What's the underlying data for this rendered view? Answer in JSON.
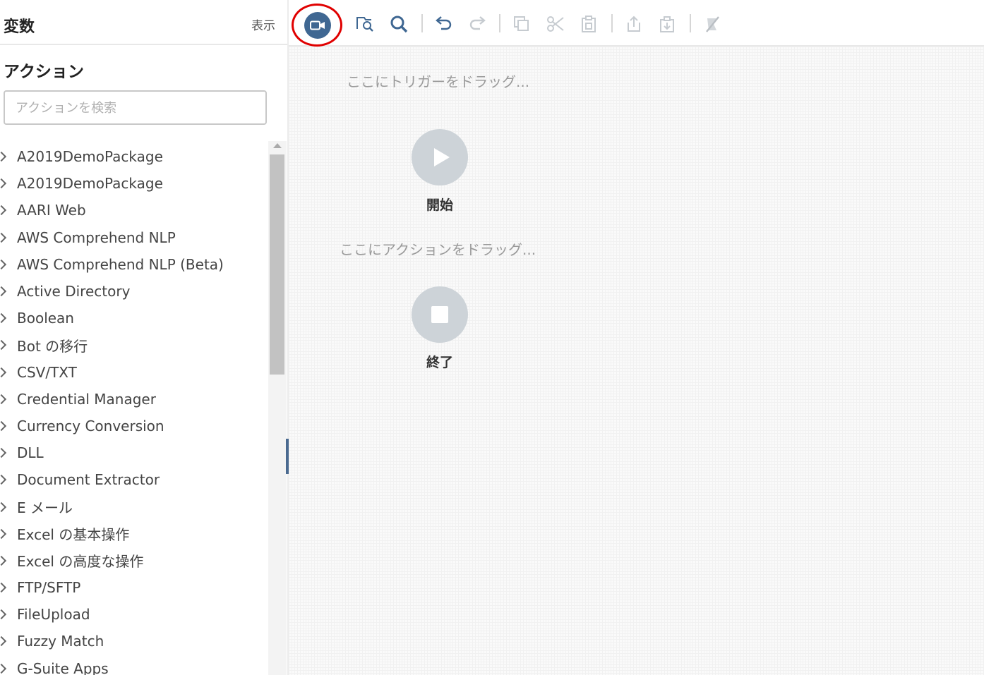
{
  "left_panel": {
    "variables_title": "変数",
    "show_label": "表示",
    "actions_title": "アクション",
    "search": {
      "placeholder": "アクションを検索",
      "value": ""
    },
    "actions": [
      "A2019DemoPackage",
      "A2019DemoPackage",
      "AARI Web",
      "AWS Comprehend NLP",
      "AWS Comprehend NLP (Beta)",
      "Active Directory",
      "Boolean",
      "Bot の移行",
      "CSV/TXT",
      "Credential Manager",
      "Currency Conversion",
      "DLL",
      "Document Extractor",
      "E メール",
      "Excel の基本操作",
      "Excel の高度な操作",
      "FTP/SFTP",
      "FileUpload",
      "Fuzzy Match",
      "G-Suite Apps"
    ]
  },
  "toolbar": {
    "buttons": [
      {
        "icon": "record-icon",
        "highlighted": true,
        "enabled": true
      },
      {
        "icon": "find-in-flow-icon",
        "enabled": true
      },
      {
        "icon": "search-icon",
        "enabled": true
      },
      {
        "icon": "undo-icon",
        "enabled": true
      },
      {
        "icon": "redo-icon",
        "enabled": false
      },
      {
        "icon": "copy-icon",
        "enabled": false
      },
      {
        "icon": "cut-icon",
        "enabled": false
      },
      {
        "icon": "paste-icon",
        "enabled": false
      },
      {
        "icon": "export-icon",
        "enabled": false
      },
      {
        "icon": "import-icon",
        "enabled": false
      },
      {
        "icon": "disable-icon",
        "enabled": false
      }
    ],
    "colors": {
      "record": "#3f6792",
      "highlight": "#e00000"
    }
  },
  "canvas": {
    "trigger_hint": "ここにトリガーをドラッグ...",
    "action_hint": "ここにアクションをドラッグ...",
    "start_label": "開始",
    "end_label": "終了"
  }
}
